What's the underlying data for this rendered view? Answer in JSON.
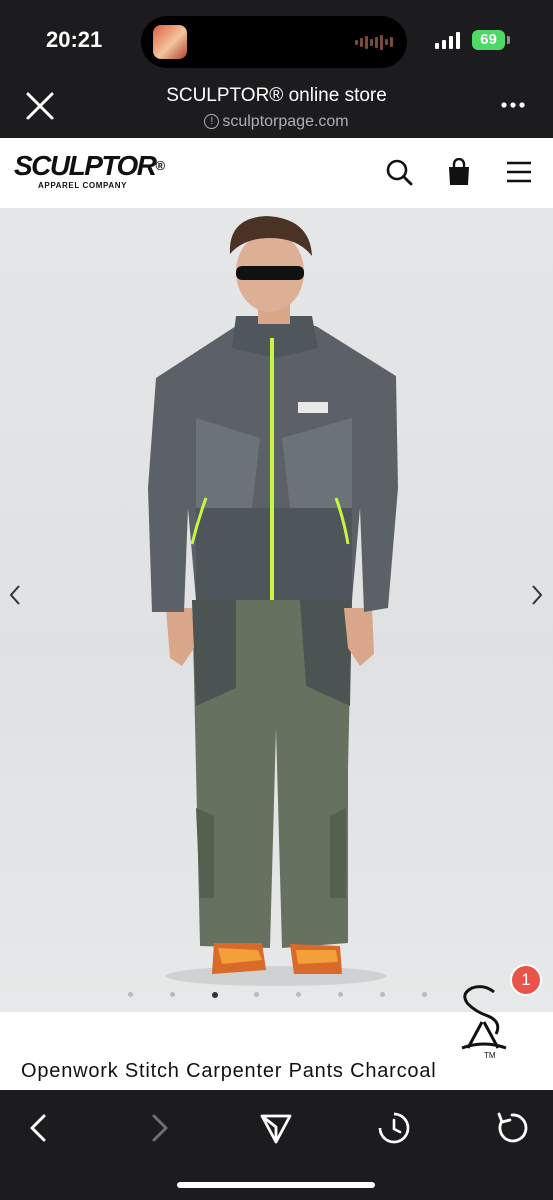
{
  "status_bar": {
    "time": "20:21",
    "battery": "69"
  },
  "browser": {
    "title": "SCULPTOR® online store",
    "url": "sculptorpage.com"
  },
  "site_header": {
    "logo_text": "SCULPTOR",
    "logo_reg": "®",
    "logo_sub": "APPAREL COMPANY"
  },
  "carousel": {
    "slide_count": 8,
    "active_index": 2
  },
  "brandmark": {
    "tm": "TM"
  },
  "notification_badge": "1",
  "product": {
    "name": "Openwork Stitch Carpenter Pants Charcoal"
  },
  "colors": {
    "system_bar": "#1c1c1e",
    "battery_green": "#4cd964",
    "badge_red": "#e8534a",
    "zipper_neon": "#c8f542"
  },
  "icons": {
    "close": "close-icon",
    "more": "more-horizontal-icon",
    "search": "search-icon",
    "cart": "shopping-bag-icon",
    "menu": "hamburger-menu-icon",
    "prev": "chevron-left-icon",
    "next": "chevron-right-icon",
    "back": "back-icon",
    "forward": "forward-icon",
    "share": "share-icon",
    "history": "history-icon",
    "reload": "reload-icon"
  }
}
